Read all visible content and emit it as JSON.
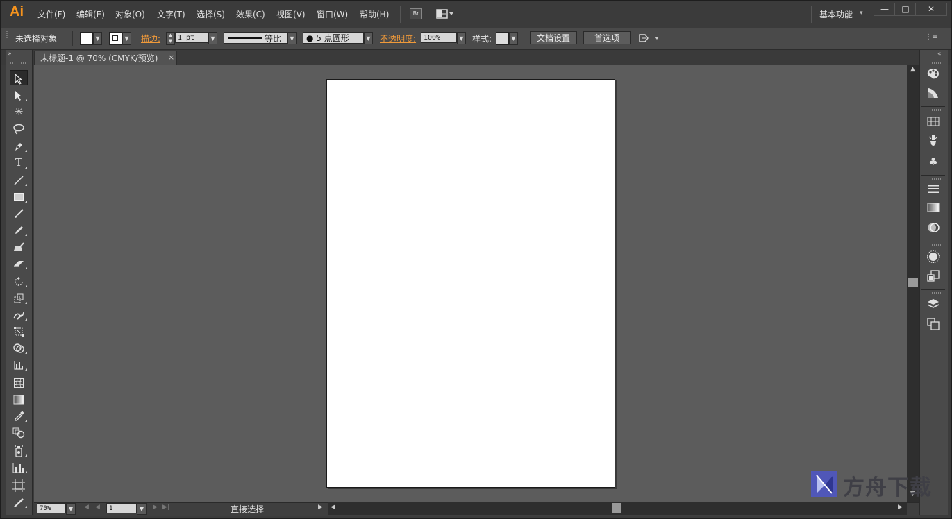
{
  "app": {
    "logo": "Ai"
  },
  "menu": {
    "items": [
      "文件(F)",
      "编辑(E)",
      "对象(O)",
      "文字(T)",
      "选择(S)",
      "效果(C)",
      "视图(V)",
      "窗口(W)",
      "帮助(H)"
    ],
    "bridge_icon": "Br",
    "workspace": "基本功能"
  },
  "window_controls": {
    "minimize": "—",
    "maximize": "□",
    "close": "✕"
  },
  "control_bar": {
    "selection_status": "未选择对象",
    "stroke_label": "描边:",
    "stroke_weight": "1 pt",
    "stroke_profile": "等比",
    "brush_label": "● 5 点圆形",
    "opacity_label": "不透明度:",
    "opacity_value": "100%",
    "style_label": "样式:",
    "document_setup_button": "文档设置",
    "preferences_button": "首选项"
  },
  "document_tab": {
    "title": "未标题-1 @ 70% (CMYK/预览)",
    "close": "×"
  },
  "tools": [
    "selection-tool",
    "direct-selection-tool",
    "magic-wand-tool",
    "lasso-tool",
    "pen-tool",
    "type-tool",
    "line-segment-tool",
    "rectangle-tool",
    "paintbrush-tool",
    "pencil-tool",
    "blob-brush-tool",
    "eraser-tool",
    "rotate-tool",
    "scale-tool",
    "warp-tool",
    "free-transform-tool",
    "shape-builder-tool",
    "graph-tool",
    "mesh-tool",
    "gradient-tool",
    "eyedropper-tool",
    "blend-tool",
    "symbol-sprayer-tool",
    "column-graph-tool",
    "artboard-tool",
    "slice-tool"
  ],
  "status_bar": {
    "zoom": "70%",
    "page": "1",
    "current_tool": "直接选择"
  },
  "right_dock": [
    "color-panel",
    "color-guide-panel",
    "swatches-panel",
    "brushes-panel",
    "symbols-panel",
    "stroke-panel",
    "gradient-panel",
    "transparency-panel",
    "appearance-panel",
    "graphic-styles-panel",
    "layers-panel",
    "artboards-panel"
  ],
  "watermark": {
    "text": "方舟下载"
  },
  "colors": {
    "accent_orange": "#f7941d",
    "canvas_bg": "#5c5c5c",
    "panel_bg": "#4a4a4a",
    "artboard": "#ffffff"
  }
}
